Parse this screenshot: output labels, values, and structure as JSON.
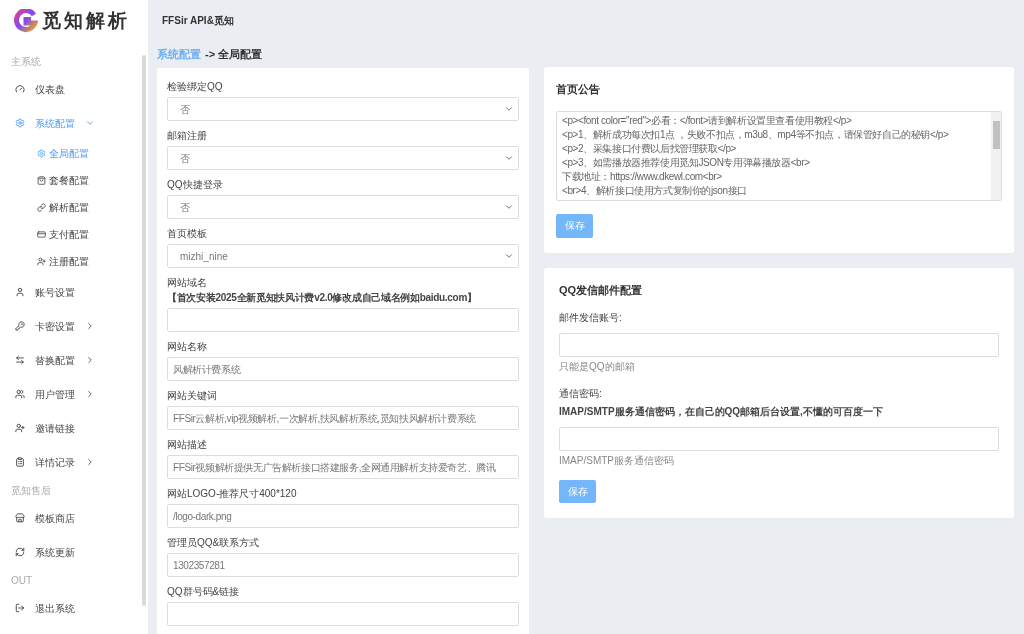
{
  "logo": {
    "text": "觅知解析"
  },
  "header": {
    "title": "FFSir API&觅知"
  },
  "sidebar": {
    "items": [
      {
        "kind": "heading",
        "label": "主系统"
      },
      {
        "kind": "item",
        "label": "仪表盘",
        "selected": false
      },
      {
        "kind": "item",
        "label": "系统配置",
        "selected": true,
        "expanded": true,
        "children": [
          {
            "label": "全局配置",
            "selected": true
          },
          {
            "label": "套餐配置",
            "selected": false
          },
          {
            "label": "解析配置",
            "selected": false
          },
          {
            "label": "支付配置",
            "selected": false
          },
          {
            "label": "注册配置",
            "selected": false
          }
        ]
      },
      {
        "kind": "item",
        "label": "账号设置",
        "selected": false
      },
      {
        "kind": "item",
        "label": "卡密设置",
        "selected": false,
        "expanded": false
      },
      {
        "kind": "item",
        "label": "替换配置",
        "selected": false,
        "expanded": false
      },
      {
        "kind": "item",
        "label": "用户管理",
        "selected": false,
        "expanded": false
      },
      {
        "kind": "item",
        "label": "邀请链接",
        "selected": false
      },
      {
        "kind": "item",
        "label": "详情记录",
        "selected": false,
        "expanded": false
      },
      {
        "kind": "heading",
        "label": "觅知售后"
      },
      {
        "kind": "item",
        "label": "模板商店",
        "selected": false
      },
      {
        "kind": "item",
        "label": "系统更新",
        "selected": false
      },
      {
        "kind": "heading",
        "label": "OUT"
      },
      {
        "kind": "item",
        "label": "退出系统",
        "selected": false
      }
    ]
  },
  "breadcrumb": {
    "parent": "系统配置",
    "separator": "->",
    "current": "全局配置"
  },
  "global_form": {
    "fields": [
      {
        "kind": "select",
        "label": "检验绑定QQ",
        "value": "否"
      },
      {
        "kind": "select",
        "label": "邮箱注册",
        "value": "否"
      },
      {
        "kind": "select",
        "label": "QQ快捷登录",
        "value": "否"
      },
      {
        "kind": "select",
        "label": "首页模板",
        "value": "mizhi_nine"
      },
      {
        "kind": "input",
        "label": "网站域名",
        "hint": "【首次安装2025全新觅知扶风计费v2.0修改成自己域名例如baidu.com】"
      },
      {
        "kind": "input",
        "label": "网站名称",
        "value": "风解析计费系统"
      },
      {
        "kind": "input",
        "label": "网站关键词",
        "value": "FFSir云解析,vip视频解析,一次解析,扶风解析系统,觅知扶风解析计费系统"
      },
      {
        "kind": "input",
        "label": "网站描述",
        "value": "FFSir视频解析提供无广告解析接口搭建服务,全网通用解析支持爱奇艺、腾讯"
      },
      {
        "kind": "input",
        "label": "网站LOGO-推荐尺寸400*120",
        "value": "/logo-dark.png"
      },
      {
        "kind": "input",
        "label": "管理员QQ&联系方式",
        "value": "1302357281"
      },
      {
        "kind": "input",
        "label": "QQ群号码&链接"
      }
    ]
  },
  "notice_card": {
    "title": "首页公告",
    "lines": [
      "<p><font color=\"red\">必看：</font>请到解析设置里查看使用教程</p>",
      "<p>1、解析成功每次扣1点 ，失败不扣点，m3u8、mp4等不扣点，请保管好自己的秘钥</p>",
      "<p>2、采集接口付费以后找管理获取</p>",
      "<p>3、如需播放器推荐使用觅知JSON专用弹幕播放器<br>",
      "下载地址：https://www.dkewl.com<br>",
      "<br>4、解析接口使用方式复制你的json接口"
    ],
    "button": "保存"
  },
  "mail_card": {
    "title": "QQ发信邮件配置",
    "fields": [
      {
        "label": "邮件发信账号:",
        "help": "只能是QQ的邮箱"
      },
      {
        "label": "通信密码:",
        "hint": "IMAP/SMTP服务通信密码，在自己的QQ邮箱后台设置,不懂的可百度一下",
        "help": "IMAP/SMTP服务通信密码"
      }
    ],
    "button": "保存"
  }
}
